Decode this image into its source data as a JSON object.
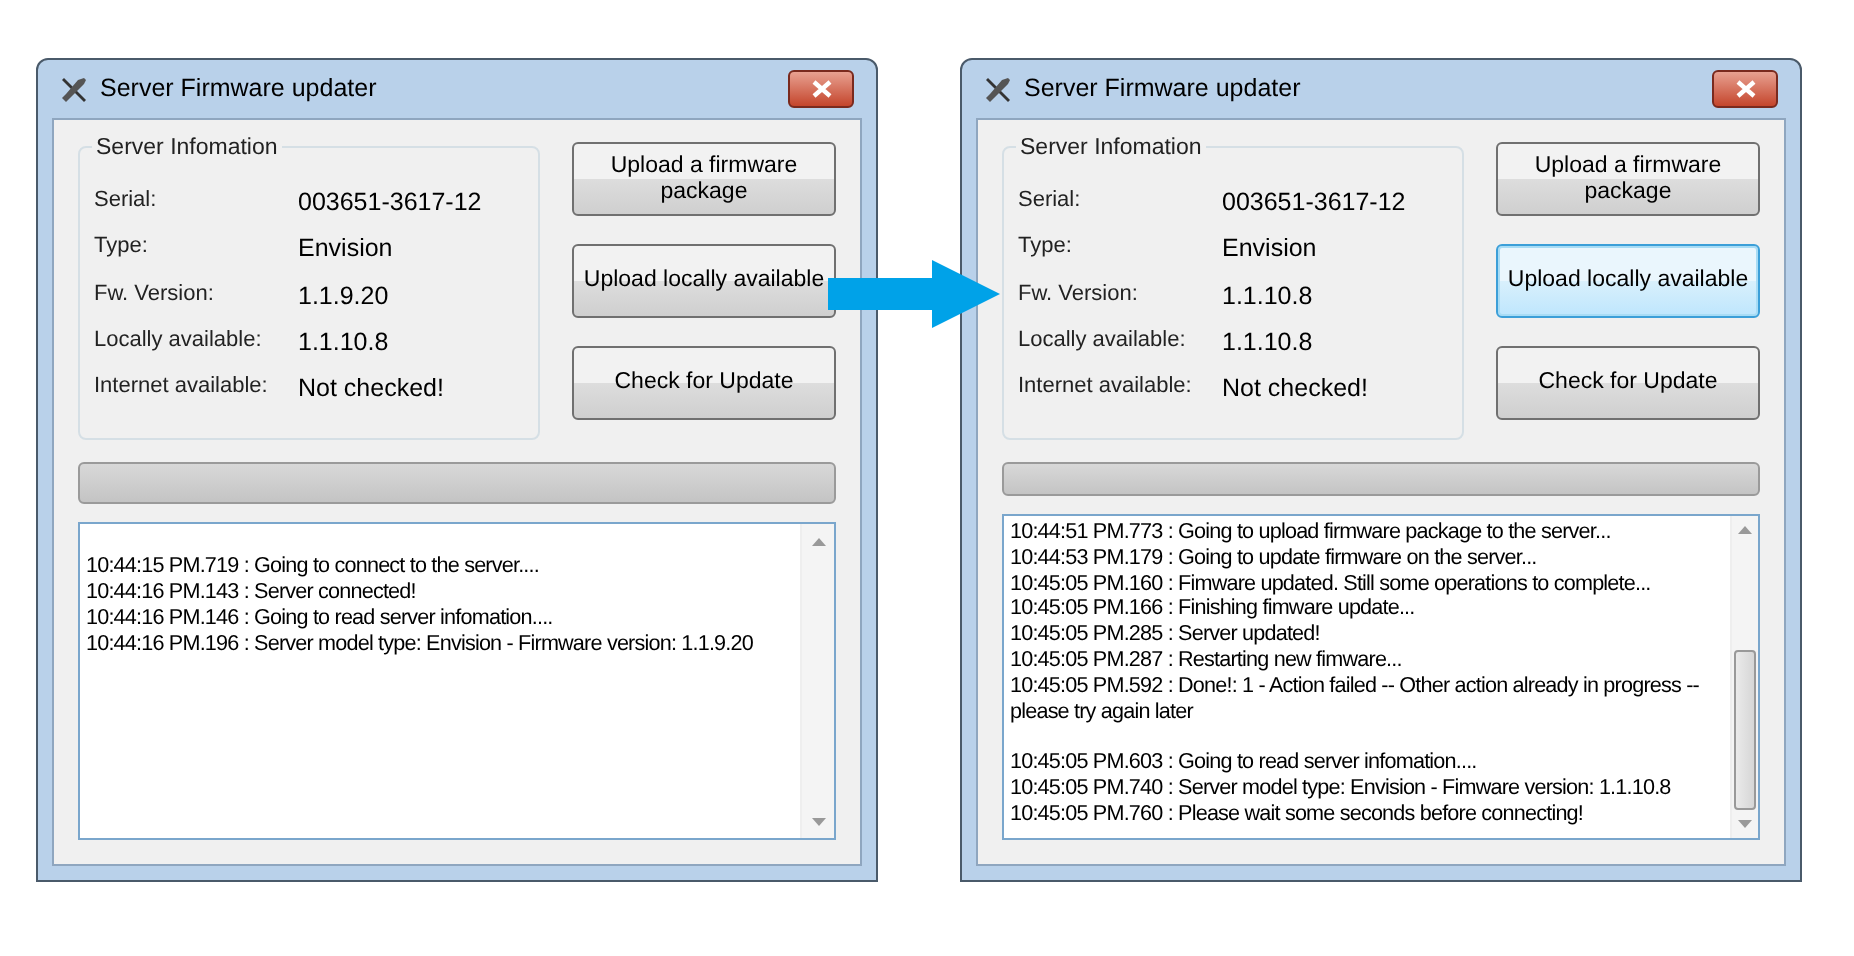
{
  "windows": [
    {
      "title": "Server Firmware updater",
      "group_title": "Server Infomation",
      "info": [
        {
          "label": "Serial:",
          "value": "003651-3617-12"
        },
        {
          "label": "Type:",
          "value": "Envision"
        },
        {
          "label": "Fw. Version:",
          "value": "1.1.9.20"
        },
        {
          "label": "Locally available:",
          "value": "1.1.10.8"
        },
        {
          "label": "Internet available:",
          "value": "Not checked!"
        }
      ],
      "buttons": [
        {
          "label": "Upload a firmware package",
          "focused": false
        },
        {
          "label": "Upload locally available",
          "focused": false
        },
        {
          "label": "Check for Update",
          "focused": false
        }
      ],
      "progress": {
        "level": 0
      },
      "log": {
        "scrolled": false,
        "lines": [
          {
            "text": "10:44:15 PM.719 : Going to connect to the server....",
            "blank_before": true
          },
          {
            "text": "10:44:16 PM.143 : Server connected!",
            "blank_before": false
          },
          {
            "text": "10:44:16 PM.146 : Going to read server infomation....",
            "blank_before": false
          },
          {
            "text": "10:44:16 PM.196 : Server model type: Envision - Firmware version: 1.1.9.20",
            "blank_before": false
          }
        ]
      }
    },
    {
      "title": "Server Firmware updater",
      "group_title": "Server Infomation",
      "info": [
        {
          "label": "Serial:",
          "value": "003651-3617-12"
        },
        {
          "label": "Type:",
          "value": "Envision"
        },
        {
          "label": "Fw. Version:",
          "value": "1.1.10.8"
        },
        {
          "label": "Locally available:",
          "value": "1.1.10.8"
        },
        {
          "label": "Internet available:",
          "value": "Not checked!"
        }
      ],
      "buttons": [
        {
          "label": "Upload a firmware package",
          "focused": false
        },
        {
          "label": "Upload locally available",
          "focused": true
        },
        {
          "label": "Check for Update",
          "focused": false
        }
      ],
      "progress": {
        "level": 0
      },
      "log": {
        "scrolled": true,
        "lines": [
          {
            "text": "10:44:51 PM.773 : Going to upload firmware package to the server...",
            "blank_before": false
          },
          {
            "text": "10:44:53 PM.179 : Going to update firmware on the server...",
            "blank_before": false
          },
          {
            "text": "10:45:05 PM.160 : Fimware updated. Still some operations to complete...",
            "blank_before": false
          },
          {
            "text": "10:45:05 PM.166 : Finishing fimware update...",
            "blank_before": false
          },
          {
            "text": "10:45:05 PM.285 : Server updated!",
            "blank_before": false
          },
          {
            "text": "10:45:05 PM.287 : Restarting new fimware...",
            "blank_before": false
          },
          {
            "text": "10:45:05 PM.592 : Done!: 1 - Action failed -- Other action already in progress -- please try again later",
            "blank_before": false
          },
          {
            "text": "10:45:05 PM.603 : Going to read server infomation....",
            "blank_before": true
          },
          {
            "text": "10:45:05 PM.740 : Server model type: Envision - Fimware version: 1.1.10.8",
            "blank_before": false
          },
          {
            "text": "10:45:05 PM.760 : Please wait some seconds before connecting!",
            "blank_before": false
          }
        ]
      }
    }
  ]
}
